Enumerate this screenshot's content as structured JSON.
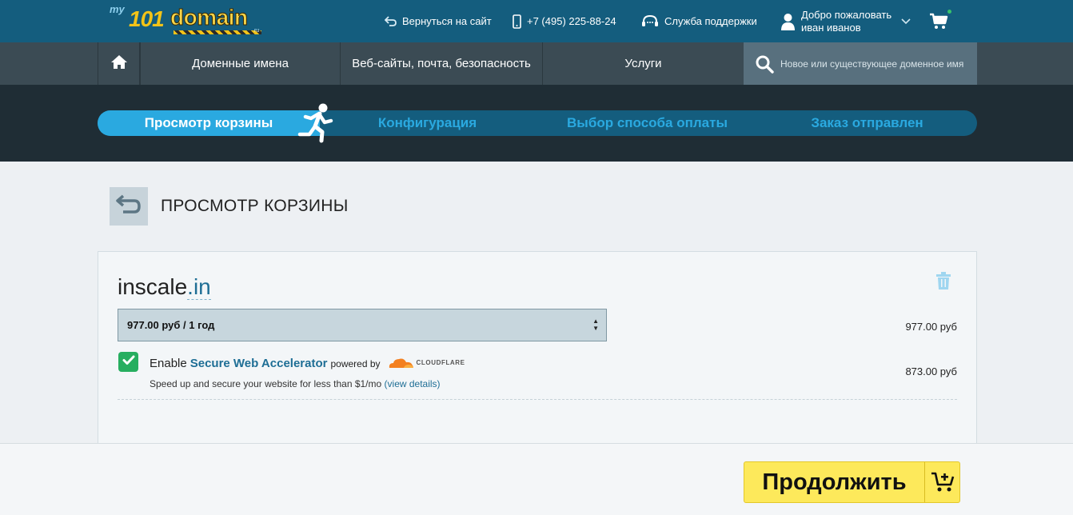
{
  "logo": {
    "my": "my",
    "num": "101",
    "domain": "domain",
    "ru": "ru"
  },
  "header": {
    "back_to_site": "Вернуться на сайт",
    "phone": "+7 (495) 225-88-24",
    "support": "Служба поддержки",
    "greeting": "Добро пожаловать",
    "user_name": "иван иванов"
  },
  "nav": {
    "domains": "Доменные имена",
    "web": "Веб-сайты, почта, безопасность",
    "services": "Услуги",
    "search_placeholder": "Новое или существующее доменное имя"
  },
  "steps": {
    "current": 1,
    "items": [
      "Просмотр корзины",
      "Конфигурация",
      "Выбор способа оплаты",
      "Заказ отправлен"
    ]
  },
  "page": {
    "title": "ПРОСМОТР КОРЗИНЫ"
  },
  "cart": {
    "domain_sld": "inscale",
    "domain_tld": ".in",
    "period_price": "977.00",
    "period_rest": "руб / 1 год",
    "item_price": "977.00 руб",
    "addon": {
      "enable": "Enable",
      "name": "Secure Web Accelerator",
      "powered_by": "powered by",
      "brand": "CLOUDFLARE",
      "description": "Speed up and secure your website for less than $1/mo",
      "details_link": "(view details)",
      "price": "873.00 руб",
      "checked": true
    }
  },
  "footer": {
    "continue": "Продолжить"
  },
  "colors": {
    "header": "#145d7e",
    "nav": "#3b4b54",
    "accent": "#2aa9e0",
    "button": "#fde95b",
    "check": "#27ae60"
  },
  "icons": [
    "back-arrow-icon",
    "phone-icon",
    "headset-icon",
    "user-icon",
    "chevron-down-icon",
    "cart-icon",
    "home-icon",
    "search-icon",
    "runner-icon",
    "return-icon",
    "trash-icon",
    "checkmark-icon",
    "cloudflare-icon",
    "cart-add-icon"
  ]
}
